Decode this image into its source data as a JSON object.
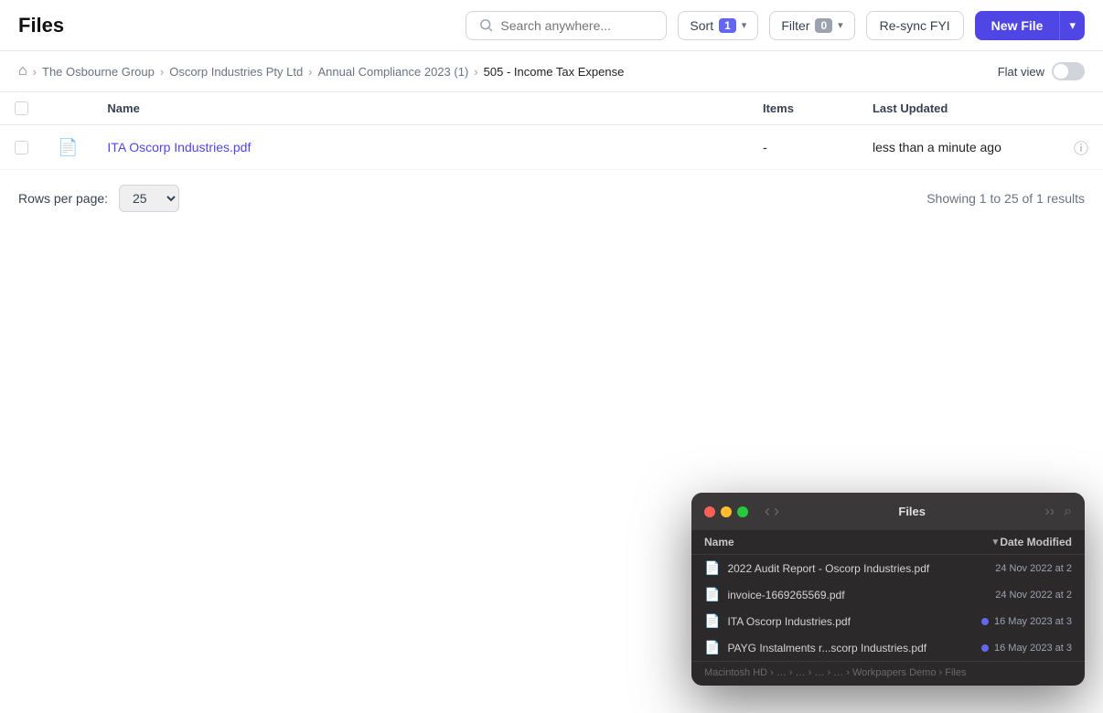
{
  "header": {
    "title": "Files",
    "search": {
      "placeholder": "Search anywhere..."
    },
    "sort": {
      "label": "Sort",
      "count": 1
    },
    "filter": {
      "label": "Filter",
      "count": 0
    },
    "resync": {
      "label": "Re-sync FYI"
    },
    "new_file": {
      "label": "New File"
    }
  },
  "breadcrumb": {
    "home_label": "home",
    "items": [
      {
        "label": "The Osbourne Group"
      },
      {
        "label": "Oscorp Industries Pty Ltd"
      },
      {
        "label": "Annual Compliance 2023 (1)"
      },
      {
        "label": "505 - Income Tax Expense"
      }
    ],
    "flat_view": "Flat view"
  },
  "table": {
    "columns": [
      "Name",
      "Items",
      "Last Updated"
    ],
    "rows": [
      {
        "name": "ITA Oscorp Industries.pdf",
        "items": "-",
        "last_updated": "less than a minute ago"
      }
    ]
  },
  "pagination": {
    "rows_label": "Rows per page:",
    "rows_value": "25",
    "showing": "Showing 1 to 25 of 1 results"
  },
  "finder": {
    "title": "Files",
    "col_name": "Name",
    "col_date": "Date Modified",
    "files": [
      {
        "name": "2022 Audit Report - Oscorp Industries.pdf",
        "date": "24 Nov 2022 at 2",
        "dot": false
      },
      {
        "name": "invoice-1669265569.pdf",
        "date": "24 Nov 2022 at 2",
        "dot": false
      },
      {
        "name": "ITA Oscorp Industries.pdf",
        "date": "16 May 2023 at 3",
        "dot": true
      },
      {
        "name": "PAYG Instalments r...scorp Industries.pdf",
        "date": "16 May 2023 at 3",
        "dot": true
      }
    ],
    "statusbar": {
      "path": "Macintosh HD › … › … › … › … › Workpapers Demo › Files"
    }
  }
}
